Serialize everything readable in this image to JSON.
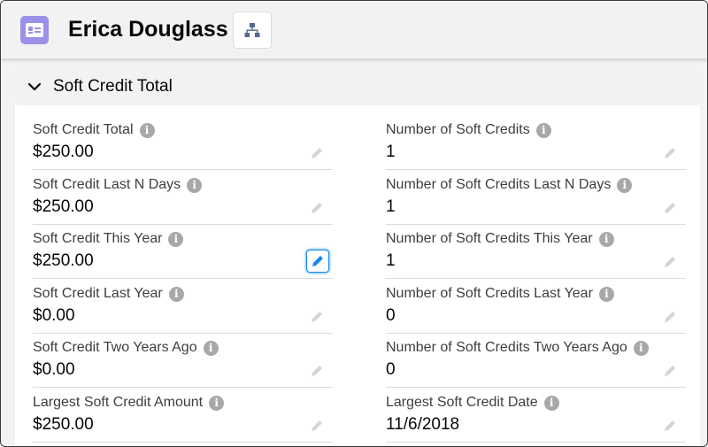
{
  "header": {
    "record_name": "Erica Douglass",
    "record_icon": "contact-card-icon",
    "hierarchy_icon": "hierarchy-icon",
    "icon_color": "#9b90e8"
  },
  "section": {
    "title": "Soft Credit Total",
    "expanded": true
  },
  "fields": {
    "left": [
      {
        "label": "Soft Credit Total",
        "value": "$250.00"
      },
      {
        "label": "Soft Credit Last N Days",
        "value": "$250.00"
      },
      {
        "label": "Soft Credit This Year",
        "value": "$250.00"
      },
      {
        "label": "Soft Credit Last Year",
        "value": "$0.00"
      },
      {
        "label": "Soft Credit Two Years Ago",
        "value": "$0.00"
      },
      {
        "label": "Largest Soft Credit Amount",
        "value": "$250.00"
      }
    ],
    "right": [
      {
        "label": "Number of Soft Credits",
        "value": "1"
      },
      {
        "label": "Number of Soft Credits Last N Days",
        "value": "1"
      },
      {
        "label": "Number of Soft Credits This Year",
        "value": "1"
      },
      {
        "label": "Number of Soft Credits Last Year",
        "value": "0"
      },
      {
        "label": "Number of Soft Credits Two Years Ago",
        "value": "0"
      },
      {
        "label": "Largest Soft Credit Date",
        "value": "11/6/2018"
      }
    ]
  },
  "colors": {
    "accent": "#1589ee",
    "info_icon": "#a8a8a8"
  }
}
